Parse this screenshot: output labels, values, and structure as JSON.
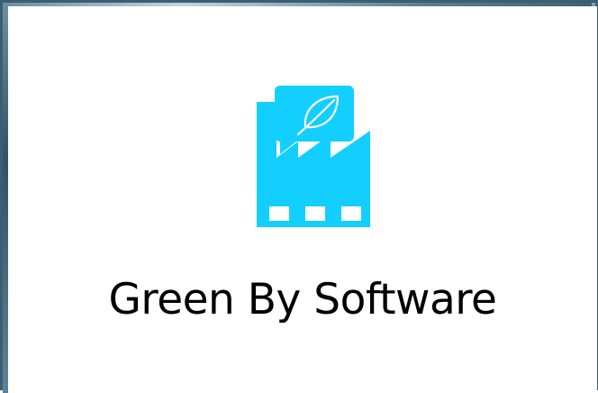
{
  "card": {
    "title": "Green By Software",
    "logo_icon": "factory-leaf-icon",
    "accent_color": "#13cfff",
    "text_color": "#000000",
    "background_color": "#ffffff"
  }
}
